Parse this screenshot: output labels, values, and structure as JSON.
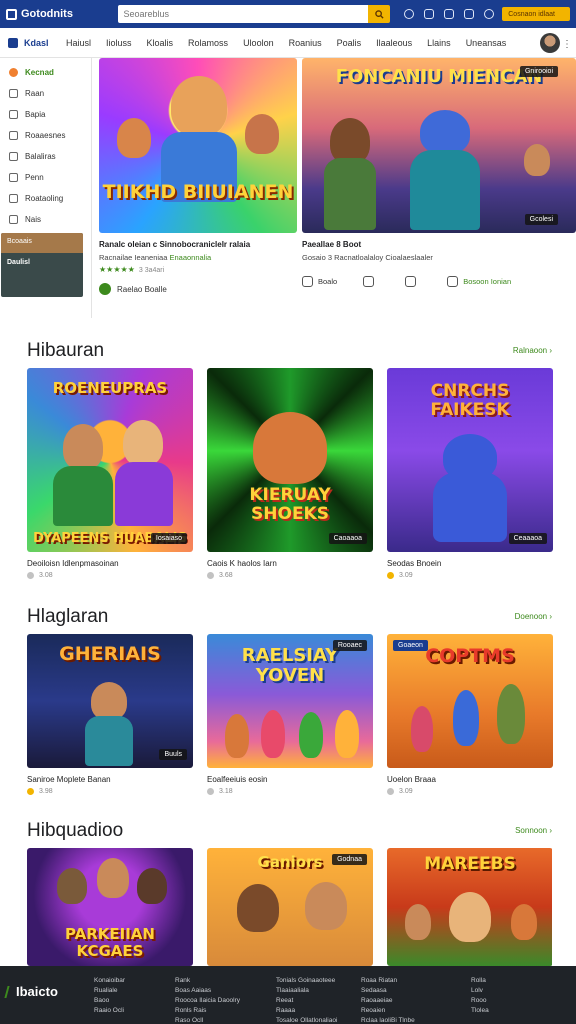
{
  "header": {
    "logo_text": "Gotodnits",
    "search_placeholder": "Seoareblus",
    "promo_label": "Cosnaon idlaat"
  },
  "nav": {
    "home_label": "Kdasl",
    "items": [
      "Haiusl",
      "Iioluss",
      "Kloalis",
      "Rolamoss",
      "Uloolon",
      "Roanius",
      "Poalis",
      "Ilaaleous",
      "Llains",
      "Uneansas"
    ]
  },
  "sidebar": {
    "items": [
      {
        "label": "Kecnad",
        "icon": "flame-icon"
      },
      {
        "label": "Raan",
        "icon": "home-icon"
      },
      {
        "label": "Bapia",
        "icon": "grid-icon"
      },
      {
        "label": "Roaaesnes",
        "icon": "controller-icon"
      },
      {
        "label": "Balaliras",
        "icon": "list-icon"
      },
      {
        "label": "Penn",
        "icon": "chat-icon"
      },
      {
        "label": "Roataoling",
        "icon": "tag-icon"
      },
      {
        "label": "Nais",
        "icon": "help-icon"
      }
    ],
    "card_top": "Bcoaais",
    "card_bottom": "Daulisl"
  },
  "hero": [
    {
      "art_title": "TIIKHD BIIUIANEN",
      "line1": "Ranalc oleian c Sinnobocraniclelr ralaia",
      "line2_a": "Racnailae Ieaneniaa",
      "line2_b": "Enaaonnalia",
      "rating": "★★★★★",
      "meta": "3 3a4ari",
      "author": "Raelao Boalle"
    },
    {
      "art_title": "FONCANIU MIENCAN",
      "badge_top": "Gnirooioi",
      "badge_bottom": "Gcolesi",
      "line1": "Paeallae 8 Boot",
      "line2_a": "Gosaio 3 Racnatloalaloy Cioalaeslaaler",
      "actions": [
        "Boalo",
        "",
        "",
        "Bosoon Ionian"
      ]
    }
  ],
  "sections": [
    {
      "title": "Hibauran",
      "link": "Ralnaoon",
      "cards": [
        {
          "art": "ROENEUPRAS",
          "art2": "DYAPEENS HUABALIS",
          "badge": "Iosaiaso",
          "label": "Deoiloisn Idlenpmasoinan",
          "meta": "3.08"
        },
        {
          "art": "KIERUAY SHOEKS",
          "badge": "Caoaaoa",
          "label": "Caois K haolos Iarn",
          "meta": "3.68"
        },
        {
          "art": "CNRCHS FAIKESK",
          "badge": "Ceaaaoa",
          "label": "Seodas Bnoein",
          "meta": "3.09"
        }
      ]
    },
    {
      "title": "Hlaglaran",
      "link": "Doenoon",
      "cards": [
        {
          "art": "GHERIAIS",
          "badge": "Buuls",
          "label": "Saniroe Moplete Banan",
          "meta": "3.98"
        },
        {
          "art": "RAELSIAY YOVEN",
          "badge": "Rooaec",
          "label": "Eoalfeeiuis eosin",
          "meta": "3.18"
        },
        {
          "art": "COPTMS",
          "badge": "Goaeon",
          "label": "Uoelon Braaa",
          "meta": "3.09"
        }
      ]
    },
    {
      "title": "Hibquadioo",
      "link": "Sonnoon",
      "cards": [
        {
          "art": "PARKEIIAN KCGAES",
          "badge": "",
          "label": "",
          "meta": ""
        },
        {
          "art": "Ganiors",
          "badge": "Godnaa",
          "label": "",
          "meta": ""
        },
        {
          "art": "MAREEBS",
          "badge": "",
          "label": "",
          "meta": ""
        }
      ]
    }
  ],
  "footer": {
    "logo_text": "Ibaicto",
    "columns": [
      [
        "Konaioibar",
        "Rualiale",
        "Baoo",
        "Raaio Ocli"
      ],
      [
        "Rank",
        "Boas Aaiaas",
        "Roocoa Ilaicia Daoolry",
        "Ronls Rais",
        "Raso Ocll"
      ],
      [
        "Tonials Goinaaoteee",
        "Tlaaiaaliala",
        "Reeat",
        "Raaaa",
        "Tosaloe Ollatlonaliaoi"
      ],
      [
        "Roaa Riatan",
        "Sedaasa",
        "Raoaaeiae",
        "Reoaien",
        "Rclaa laoliBi Tlnbe"
      ],
      [
        "Rolla",
        "Lolv",
        "Rooo",
        "Tlolea"
      ]
    ]
  }
}
